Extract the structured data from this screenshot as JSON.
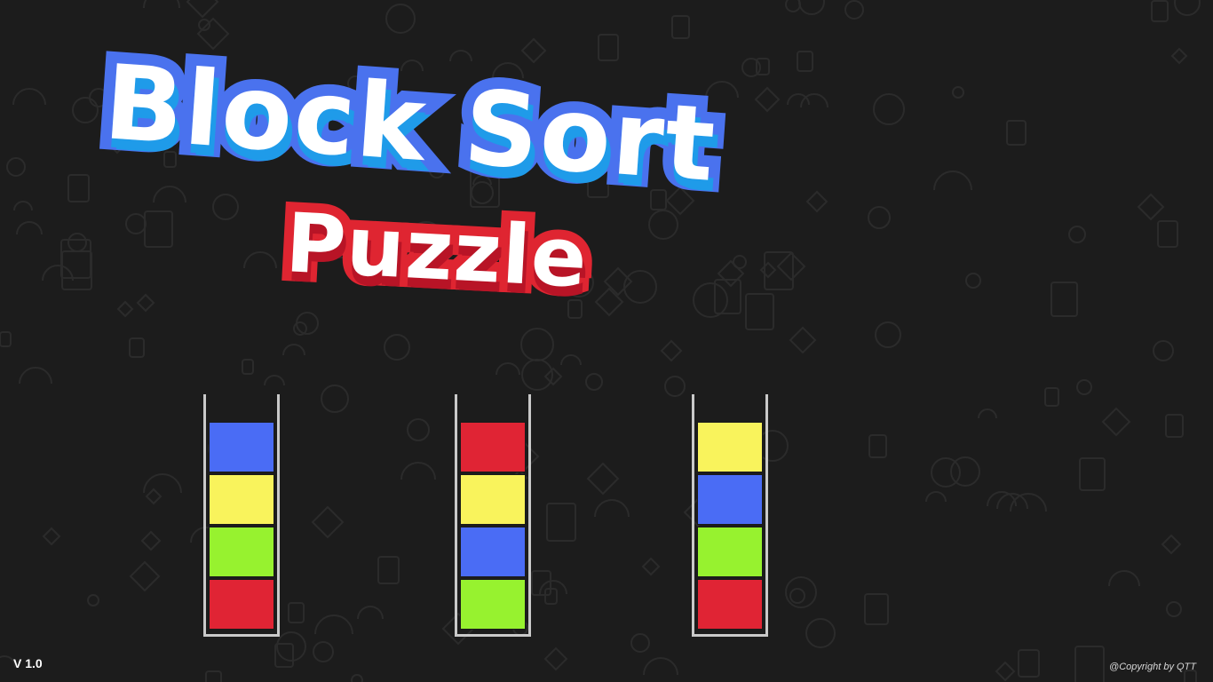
{
  "title": {
    "line1": "Block Sort",
    "line2": "Puzzle"
  },
  "colors": {
    "background": "#1c1c1c",
    "title_main_fill": "#ffffff",
    "title_main_outline": "#4a72ee",
    "title_main_shadow": "#1f9be9",
    "title_sub_outline": "#df2531",
    "title_sub_shadow": "#b81426",
    "tube_border": "#c9c9c9",
    "block_blue": "#4a6cf5",
    "block_yellow": "#f9f35c",
    "block_green": "#97f22f",
    "block_red": "#e02434"
  },
  "tubes": [
    {
      "blocks": [
        "blue",
        "yellow",
        "green",
        "red"
      ]
    },
    {
      "blocks": [
        "red",
        "yellow",
        "blue",
        "green"
      ]
    },
    {
      "blocks": [
        "yellow",
        "blue",
        "green",
        "red"
      ]
    }
  ],
  "footer": {
    "version": "V 1.0",
    "copyright": "@Copyright by QTT"
  }
}
